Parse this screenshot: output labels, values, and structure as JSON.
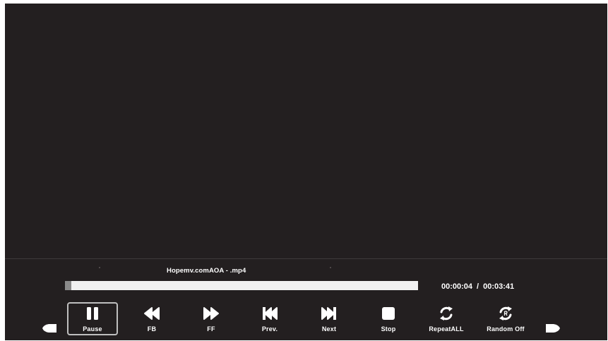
{
  "player": {
    "file_name": "Hopemv.comAOA - .mp4",
    "elapsed": "00:00:04",
    "separator": "/",
    "total": "00:03:41",
    "progress_fraction": 0.018
  },
  "controls": {
    "pause": {
      "label": "Pause",
      "icon": "pause-icon"
    },
    "fb": {
      "label": "FB",
      "icon": "fast-backward-icon"
    },
    "ff": {
      "label": "FF",
      "icon": "fast-forward-icon"
    },
    "prev": {
      "label": "Prev.",
      "icon": "previous-track-icon"
    },
    "next": {
      "label": "Next",
      "icon": "next-track-icon"
    },
    "stop": {
      "label": "Stop",
      "icon": "stop-icon"
    },
    "repeat": {
      "label": "RepeatALL",
      "icon": "repeat-icon"
    },
    "random": {
      "label": "Random Off",
      "icon": "random-icon"
    }
  },
  "nav": {
    "left_icon": "arrow-left-icon",
    "right_icon": "arrow-right-icon"
  },
  "colors": {
    "background": "#231f20",
    "text": "#ffffff",
    "progress_track": "#f1f1f1",
    "progress_fill": "#8a8a8a",
    "selection_border": "#bfbfbf"
  }
}
